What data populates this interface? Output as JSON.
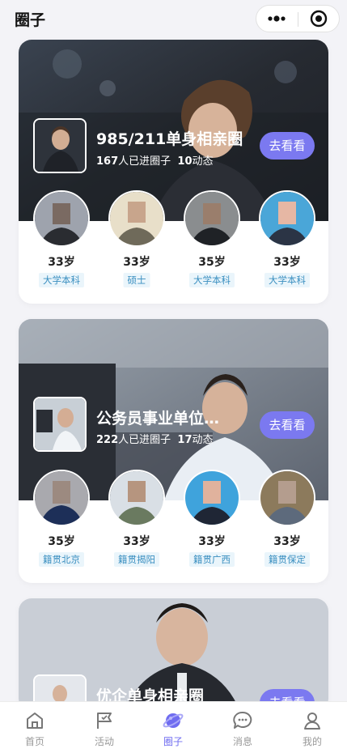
{
  "app": {
    "title": "圈子"
  },
  "capsule": {
    "more_icon": "more-dots-icon",
    "close_icon": "target-circle-icon"
  },
  "groups": [
    {
      "name": "985/211单身相亲圈",
      "member_count": "167",
      "member_suffix": "人已进圈子",
      "post_count": "10",
      "post_suffix": "动态",
      "action": "去看看",
      "members": [
        {
          "age": "33岁",
          "tag": "大学本科"
        },
        {
          "age": "33岁",
          "tag": "硕士"
        },
        {
          "age": "35岁",
          "tag": "大学本科"
        },
        {
          "age": "33岁",
          "tag": "大学本科"
        }
      ]
    },
    {
      "name": "公务员事业单位…",
      "member_count": "222",
      "member_suffix": "人已进圈子",
      "post_count": "17",
      "post_suffix": "动态",
      "action": "去看看",
      "members": [
        {
          "age": "35岁",
          "tag": "籍贯北京"
        },
        {
          "age": "33岁",
          "tag": "籍贯揭阳"
        },
        {
          "age": "33岁",
          "tag": "籍贯广西"
        },
        {
          "age": "33岁",
          "tag": "籍贯保定"
        }
      ]
    },
    {
      "name": "优企单身相亲圈",
      "action": "去看看"
    }
  ],
  "tabbar": {
    "items": [
      {
        "label": "首页",
        "icon": "home-icon"
      },
      {
        "label": "活动",
        "icon": "flag-icon"
      },
      {
        "label": "圈子",
        "icon": "planet-icon"
      },
      {
        "label": "消息",
        "icon": "chat-icon"
      },
      {
        "label": "我的",
        "icon": "user-icon"
      }
    ],
    "active_color": "#6f6cf0",
    "inactive_color": "#999999"
  },
  "colors": {
    "accent": "#7b79f0",
    "tag_bg": "#eaf5fb",
    "tag_text": "#3a8fc0"
  }
}
